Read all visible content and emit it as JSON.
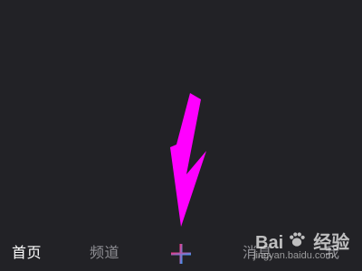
{
  "tabbar": {
    "home": "首页",
    "channel": "频道",
    "create_icon": "plus-icon",
    "messages": "消息",
    "me": "我"
  },
  "annotation": {
    "arrow_color": "#ff00ff",
    "arrow_icon": "arrow-down-icon"
  },
  "watermark": {
    "brand_left": "Bai",
    "brand_right": "经验",
    "url": "jingyan.baidu.com"
  },
  "colors": {
    "background": "#222226",
    "active_tab": "#ffffff",
    "inactive_tab": "#8f8f94",
    "plus_gradient_start": "#ff2d78",
    "plus_gradient_end": "#2ea2ff"
  }
}
